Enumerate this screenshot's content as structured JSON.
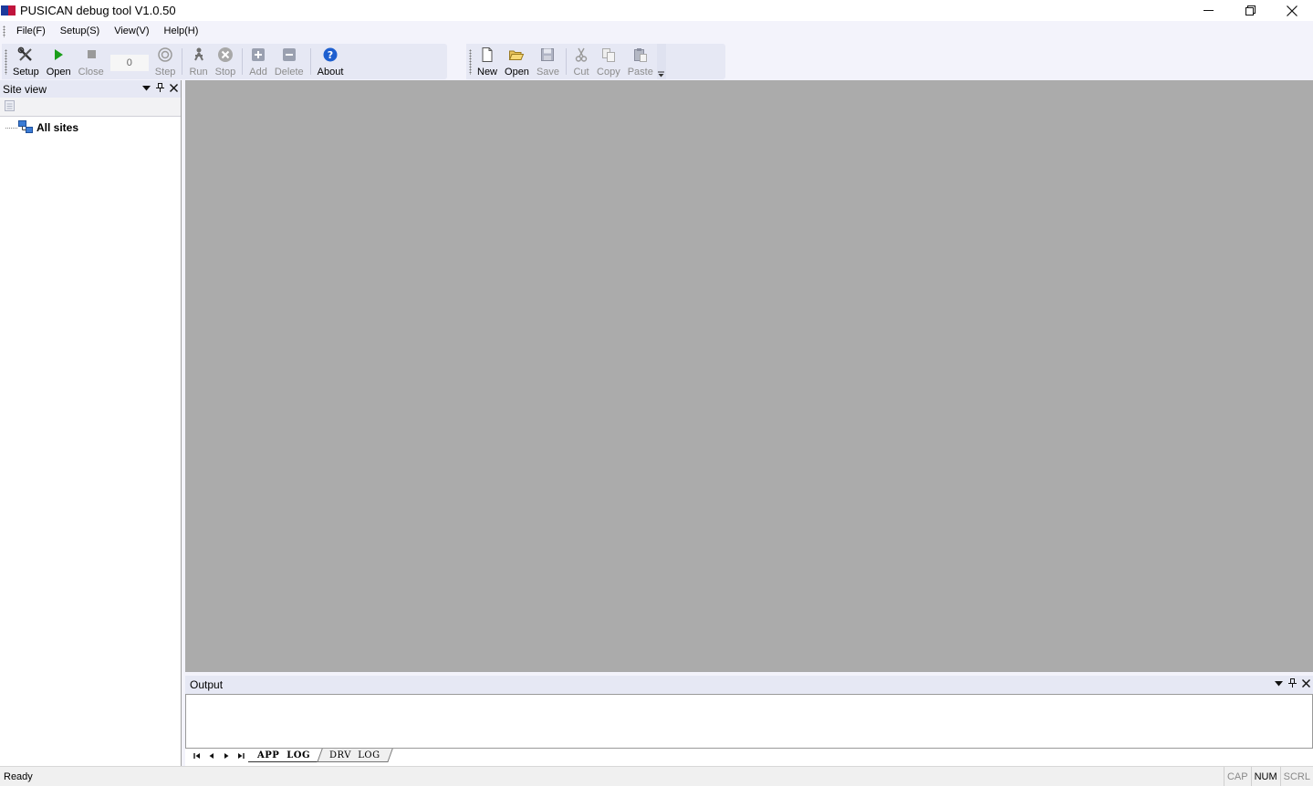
{
  "window": {
    "title": "PUSICAN debug tool V1.0.50",
    "controls": [
      "minimize",
      "restore",
      "close"
    ]
  },
  "menu": {
    "items": [
      "File(F)",
      "Setup(S)",
      "View(V)",
      "Help(H)"
    ]
  },
  "toolbar_main": {
    "setup": "Setup",
    "open": "Open",
    "close": "Close",
    "step_count": "0",
    "step": "Step",
    "run": "Run",
    "stop": "Stop",
    "add": "Add",
    "delete": "Delete",
    "about": "About"
  },
  "toolbar_edit": {
    "new": "New",
    "open": "Open",
    "save": "Save",
    "cut": "Cut",
    "copy": "Copy",
    "paste": "Paste"
  },
  "site_view": {
    "title": "Site view",
    "tree_root": "All sites"
  },
  "output": {
    "title": "Output",
    "tabs": [
      "APP  LOG",
      "DRV  LOG"
    ],
    "active_tab": "APP  LOG"
  },
  "status": {
    "text": "Ready",
    "indicators": [
      "CAP",
      "NUM",
      "SCRL"
    ],
    "active_indicator": "NUM"
  },
  "colors": {
    "workspace": "#ababab",
    "toolbar": "#e6e8f4",
    "menubar": "#f3f3fb",
    "run_green": "#1a9e1a",
    "about_blue": "#1e5fcf"
  }
}
